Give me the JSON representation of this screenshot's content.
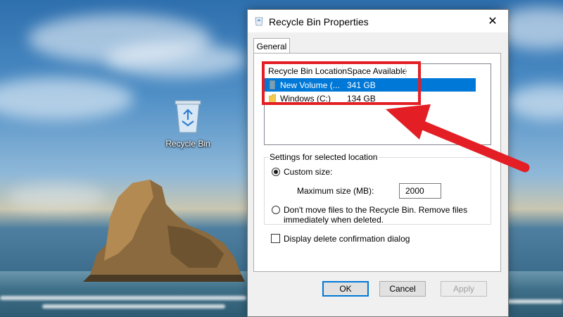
{
  "desktop": {
    "icon_label": "Recycle Bin"
  },
  "dialog": {
    "title": "Recycle Bin Properties",
    "close_symbol": "✕",
    "tab_label": "General",
    "list": {
      "columns": [
        "Recycle Bin Location",
        "Space Available"
      ],
      "rows": [
        {
          "location": "New Volume (...",
          "space": "341 GB",
          "selected": true,
          "icon": "drive-icon"
        },
        {
          "location": "Windows (C:)",
          "space": "134 GB",
          "selected": false,
          "icon": "folder-icon"
        }
      ]
    },
    "settings": {
      "legend": "Settings for selected location",
      "custom_size_label": "Custom size:",
      "max_size_label": "Maximum size (MB):",
      "max_size_value": "2000",
      "dont_move_line1": "Don't move files to the Recycle Bin. Remove files",
      "dont_move_line2": "immediately when deleted.",
      "custom_size_selected": true
    },
    "confirm_label": "Display delete confirmation dialog",
    "confirm_checked": false,
    "buttons": {
      "ok": "OK",
      "cancel": "Cancel",
      "apply": "Apply"
    }
  },
  "colors": {
    "accent": "#0078d7",
    "annotation": "#e31e24"
  }
}
